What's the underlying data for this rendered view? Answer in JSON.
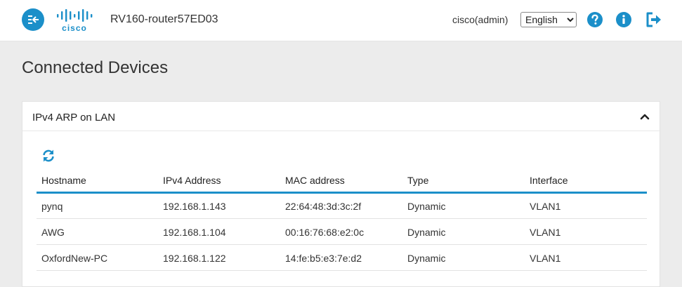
{
  "header": {
    "device_name": "RV160-router57ED03",
    "user": "cisco(admin)",
    "language": "English",
    "language_options": [
      "English"
    ],
    "brand": "cisco",
    "icons": {
      "menu": "menu-collapse-icon",
      "help": "help-icon",
      "info": "info-icon",
      "logout": "logout-icon"
    }
  },
  "page": {
    "title": "Connected Devices"
  },
  "panel": {
    "title": "IPv4 ARP on LAN",
    "refresh_icon": "refresh-icon",
    "collapse_icon": "chevron-up-icon"
  },
  "table": {
    "columns": [
      "Hostname",
      "IPv4 Address",
      "MAC address",
      "Type",
      "Interface"
    ],
    "rows": [
      [
        "pynq",
        "192.168.1.143",
        "22:64:48:3d:3c:2f",
        "Dynamic",
        "VLAN1"
      ],
      [
        "AWG",
        "192.168.1.104",
        "00:16:76:68:e2:0c",
        "Dynamic",
        "VLAN1"
      ],
      [
        "OxfordNew-PC",
        "192.168.1.122",
        "14:fe:b5:e3:7e:d2",
        "Dynamic",
        "VLAN1"
      ]
    ]
  },
  "colors": {
    "accent": "#1b8fc9",
    "band": "#ececec"
  }
}
